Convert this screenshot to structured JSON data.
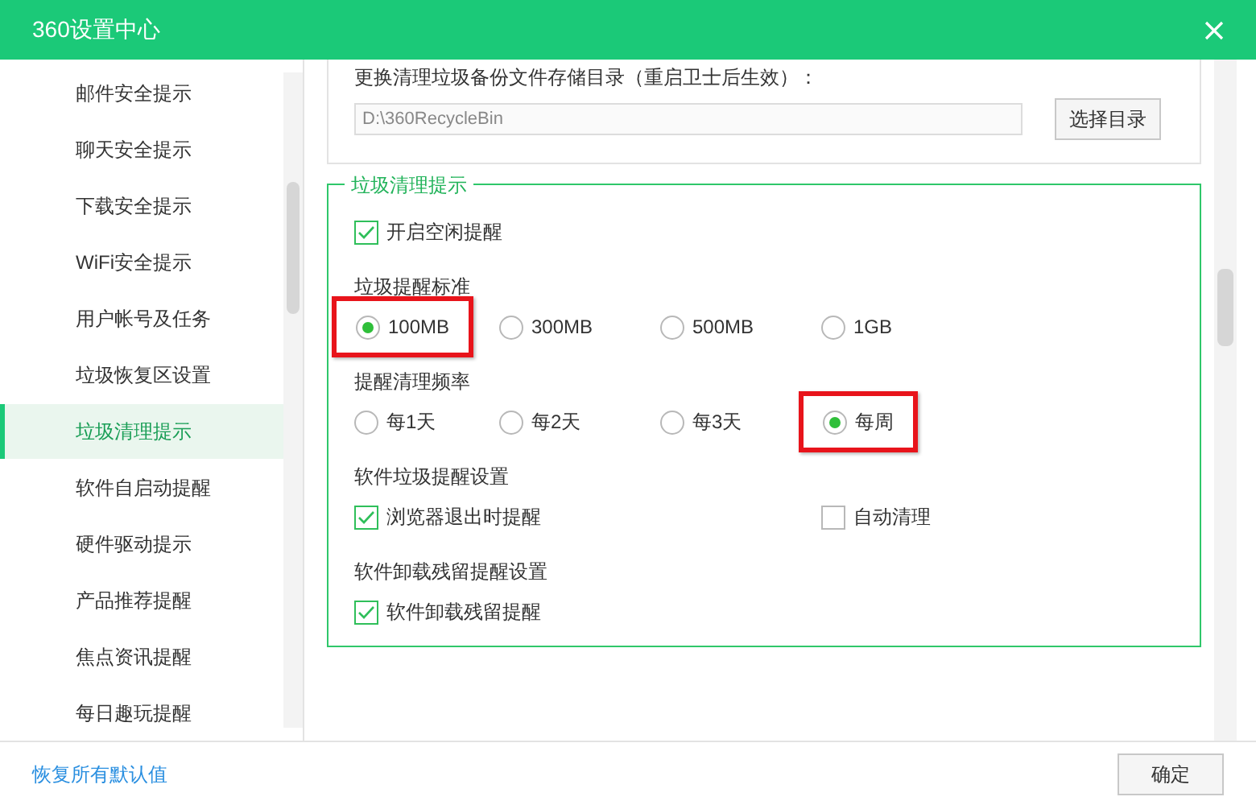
{
  "window": {
    "title": "360设置中心"
  },
  "sidebar": {
    "items": [
      {
        "label": "邮件安全提示",
        "selected": false
      },
      {
        "label": "聊天安全提示",
        "selected": false
      },
      {
        "label": "下载安全提示",
        "selected": false
      },
      {
        "label": "WiFi安全提示",
        "selected": false
      },
      {
        "label": "用户帐号及任务",
        "selected": false
      },
      {
        "label": "垃圾恢复区设置",
        "selected": false
      },
      {
        "label": "垃圾清理提示",
        "selected": true
      },
      {
        "label": "软件自启动提醒",
        "selected": false
      },
      {
        "label": "硬件驱动提示",
        "selected": false
      },
      {
        "label": "产品推荐提醒",
        "selected": false
      },
      {
        "label": "焦点资讯提醒",
        "selected": false
      },
      {
        "label": "每日趣玩提醒",
        "selected": false
      }
    ]
  },
  "backup_dir": {
    "label": "更换清理垃圾备份文件存储目录（重启卫士后生效）：",
    "value": "D:\\360RecycleBin",
    "button": "选择目录"
  },
  "group": {
    "title": "垃圾清理提示",
    "rows": [
      {
        "kind": "checks",
        "items": [
          {
            "label": "开启空闲提醒",
            "checked": true
          }
        ]
      },
      {
        "kind": "heading",
        "label": "垃圾提醒标准"
      },
      {
        "kind": "radios",
        "items": [
          {
            "label": "100MB",
            "selected": true,
            "highlighted": true
          },
          {
            "label": "300MB",
            "selected": false,
            "highlighted": false
          },
          {
            "label": "500MB",
            "selected": false,
            "highlighted": false
          },
          {
            "label": "1GB",
            "selected": false,
            "highlighted": false
          }
        ]
      },
      {
        "kind": "heading",
        "label": "提醒清理频率"
      },
      {
        "kind": "radios",
        "items": [
          {
            "label": "每1天",
            "selected": false,
            "highlighted": false
          },
          {
            "label": "每2天",
            "selected": false,
            "highlighted": false
          },
          {
            "label": "每3天",
            "selected": false,
            "highlighted": false
          },
          {
            "label": "每周",
            "selected": true,
            "highlighted": true
          }
        ]
      },
      {
        "kind": "heading",
        "label": "软件垃圾提醒设置"
      },
      {
        "kind": "checks",
        "items": [
          {
            "label": "浏览器退出时提醒",
            "checked": true
          },
          {
            "label": "自动清理",
            "checked": false
          }
        ]
      },
      {
        "kind": "heading",
        "label": "软件卸载残留提醒设置"
      },
      {
        "kind": "checks",
        "items": [
          {
            "label": "软件卸载残留提醒",
            "checked": true
          }
        ]
      }
    ]
  },
  "footer": {
    "link": "恢复所有默认值",
    "button": "确定"
  }
}
